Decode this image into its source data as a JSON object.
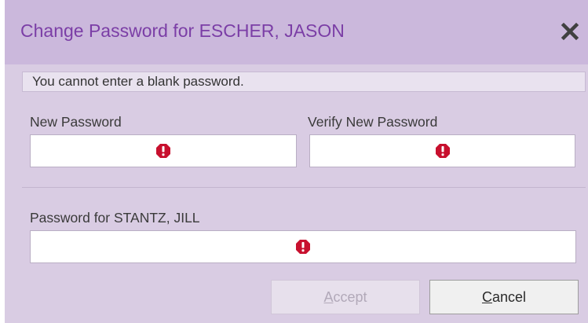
{
  "dialog": {
    "title": "Change Password for ESCHER, JASON",
    "error_message": "You cannot enter a blank password."
  },
  "fields": {
    "new_password": {
      "label": "New Password",
      "value": "",
      "error_icon": "exclamation-circle-icon"
    },
    "verify_password": {
      "label": "Verify New Password",
      "value": "",
      "error_icon": "exclamation-circle-icon"
    },
    "admin_password": {
      "label": "Password for STANTZ, JILL",
      "value": "",
      "error_icon": "exclamation-circle-icon"
    }
  },
  "buttons": {
    "accept": {
      "mnemonic": "A",
      "rest": "ccept",
      "enabled": false
    },
    "cancel": {
      "mnemonic": "C",
      "rest": "ancel",
      "enabled": true
    }
  },
  "colors": {
    "title": "#7b3ea6",
    "titlebar": "#cbb8dc",
    "body": "#d9cce3",
    "error_icon": "#c8102e"
  }
}
